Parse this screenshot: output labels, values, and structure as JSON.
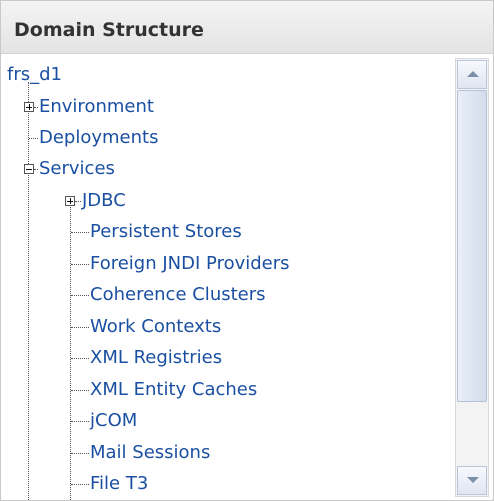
{
  "panel": {
    "title": "Domain Structure"
  },
  "tree": {
    "root": "frs_d1",
    "environment": "Environment",
    "deployments": "Deployments",
    "services": "Services",
    "jdbc": "JDBC",
    "persistent_stores": "Persistent Stores",
    "foreign_jndi": "Foreign JNDI Providers",
    "coherence": "Coherence Clusters",
    "work_contexts": "Work Contexts",
    "xml_registries": "XML Registries",
    "xml_entity_caches": "XML Entity Caches",
    "jcom": "jCOM",
    "mail_sessions": "Mail Sessions",
    "file_t3": "File T3"
  },
  "icons": [
    "expand-plus-icon",
    "collapse-minus-icon",
    "scroll-up-arrow-icon",
    "scroll-down-arrow-icon"
  ]
}
